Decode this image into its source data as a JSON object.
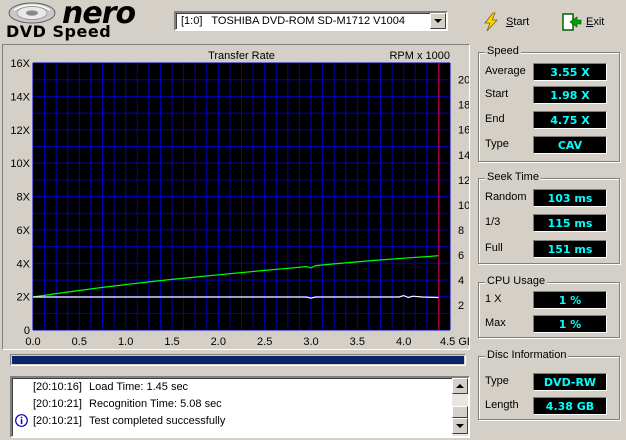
{
  "logo": {
    "word": "nero",
    "product": "DVD Speed"
  },
  "drive": {
    "selected": "[1:0]   TOSHIBA DVD-ROM SD-M1712 V1004"
  },
  "toolbar": {
    "start_label": "Start",
    "exit_label": "Exit",
    "start_icon": "lightning-icon",
    "exit_icon": "exit-door-icon"
  },
  "chart_data": {
    "type": "line",
    "title": "Transfer Rate",
    "y2label": "RPM x 1000",
    "xunit": "GB",
    "xlim": [
      0,
      4.5
    ],
    "ylim": [
      0,
      16
    ],
    "y2lim": [
      0,
      21.33
    ],
    "x_ticks": [
      "0.0",
      "0.5",
      "1.0",
      "1.5",
      "2.0",
      "2.5",
      "3.0",
      "3.5",
      "4.0",
      "4.5 GB"
    ],
    "y_ticks": [
      "0",
      "2X",
      "4X",
      "6X",
      "8X",
      "10X",
      "12X",
      "14X",
      "16X"
    ],
    "y2_ticks": [
      "2",
      "4",
      "6",
      "8",
      "10",
      "12",
      "14",
      "16",
      "18",
      "20"
    ],
    "grid": true,
    "end_marker_x": 4.38,
    "colors": {
      "background": "#000000",
      "grid": "#0000c0",
      "transfer": "#00ff00",
      "rpm": "#ffffff",
      "end_marker": "#ff0000"
    },
    "series": [
      {
        "key": "transfer",
        "values": [
          [
            0.0,
            1.98
          ],
          [
            0.25,
            2.18
          ],
          [
            0.5,
            2.37
          ],
          [
            0.75,
            2.55
          ],
          [
            1.0,
            2.72
          ],
          [
            1.25,
            2.88
          ],
          [
            1.5,
            3.03
          ],
          [
            1.75,
            3.17
          ],
          [
            2.0,
            3.31
          ],
          [
            2.25,
            3.44
          ],
          [
            2.5,
            3.57
          ],
          [
            2.75,
            3.7
          ],
          [
            2.95,
            3.8
          ],
          [
            3.0,
            3.72
          ],
          [
            3.05,
            3.86
          ],
          [
            3.25,
            3.96
          ],
          [
            3.5,
            4.08
          ],
          [
            3.75,
            4.2
          ],
          [
            4.0,
            4.3
          ],
          [
            4.25,
            4.4
          ],
          [
            4.38,
            4.45
          ]
        ]
      },
      {
        "key": "rpm",
        "values": [
          [
            0.0,
            2.64
          ],
          [
            0.5,
            2.64
          ],
          [
            1.0,
            2.64
          ],
          [
            1.5,
            2.64
          ],
          [
            2.0,
            2.64
          ],
          [
            2.5,
            2.64
          ],
          [
            2.95,
            2.64
          ],
          [
            3.0,
            2.55
          ],
          [
            3.05,
            2.64
          ],
          [
            3.5,
            2.64
          ],
          [
            3.95,
            2.64
          ],
          [
            4.0,
            2.75
          ],
          [
            4.05,
            2.6
          ],
          [
            4.1,
            2.7
          ],
          [
            4.2,
            2.64
          ],
          [
            4.38,
            2.6
          ]
        ]
      }
    ]
  },
  "progress": {
    "fraction": 1.0
  },
  "log": [
    {
      "time": "[20:10:16]",
      "message": "Load Time: 1.45 sec",
      "icon": ""
    },
    {
      "time": "[20:10:21]",
      "message": "Recognition Time: 5.08 sec",
      "icon": ""
    },
    {
      "time": "[20:10:21]",
      "message": "Test completed successfully",
      "icon": "info-icon"
    }
  ],
  "speed": {
    "title": "Speed",
    "average_label": "Average",
    "average": "3.55 X",
    "start_label": "Start",
    "start": "1.98 X",
    "end_label": "End",
    "end": "4.75 X",
    "type_label": "Type",
    "type": "CAV"
  },
  "seek": {
    "title": "Seek Time",
    "random_label": "Random",
    "random": "103 ms",
    "third_label": "1/3",
    "third": "115 ms",
    "full_label": "Full",
    "full": "151 ms"
  },
  "cpu": {
    "title": "CPU Usage",
    "x1_label": "1 X",
    "x1": "1 %",
    "max_label": "Max",
    "max": "1 %"
  },
  "disc": {
    "title": "Disc Information",
    "type_label": "Type",
    "type": "DVD-RW",
    "length_label": "Length",
    "length": "4.38 GB"
  }
}
